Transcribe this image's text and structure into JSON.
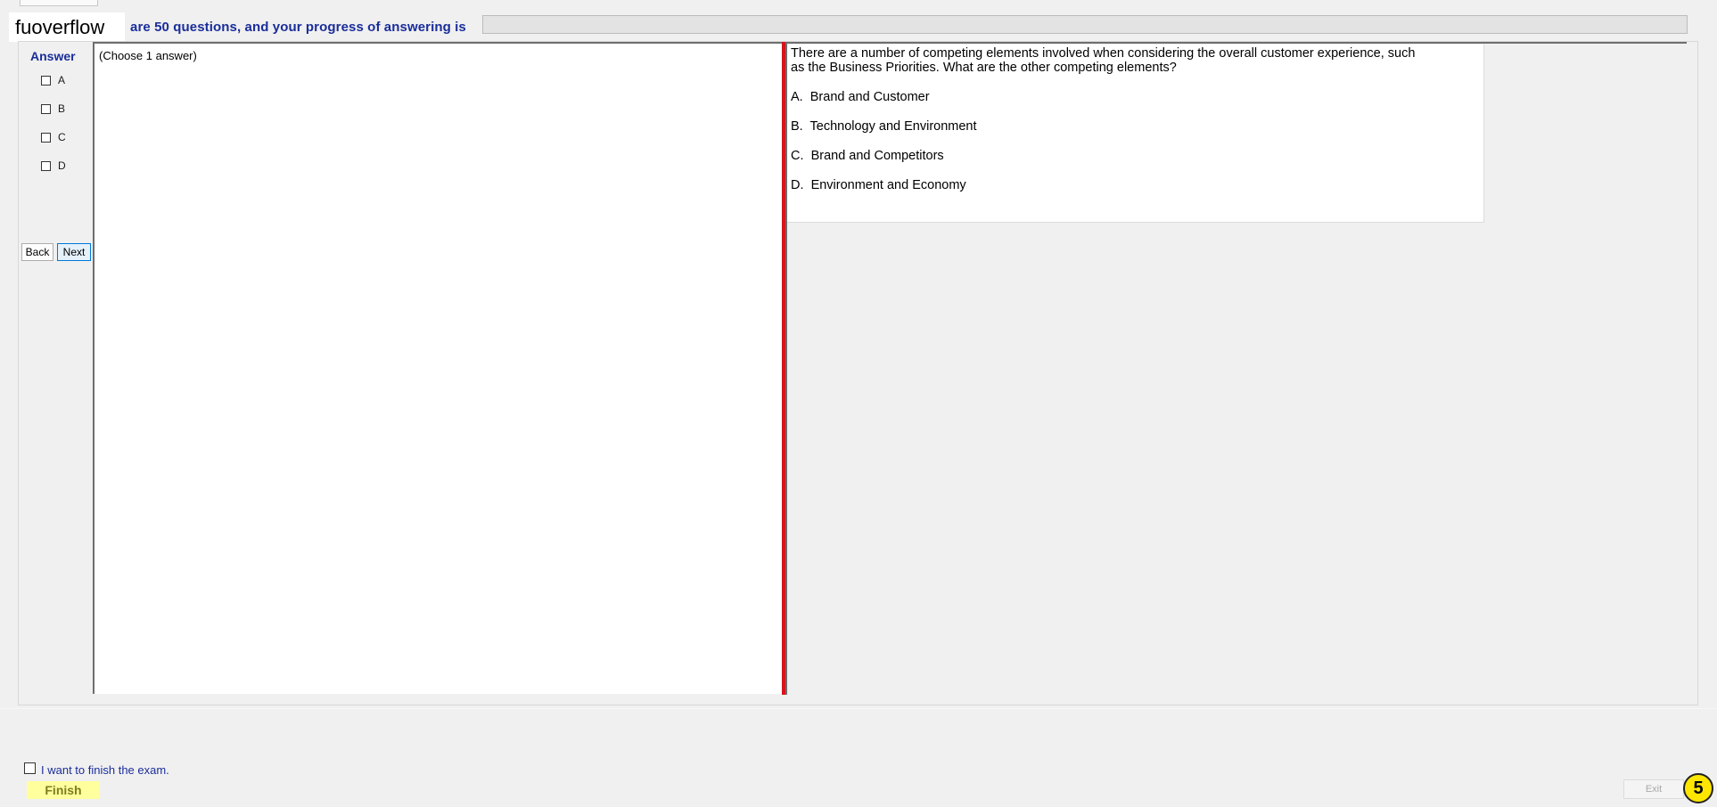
{
  "header": {
    "logo": "fuoverflow",
    "progress_text": "are 50 questions, and your progress of answering is",
    "progress": 0
  },
  "answer_panel": {
    "heading": "Answer",
    "options": [
      {
        "label": "A"
      },
      {
        "label": "B"
      },
      {
        "label": "C"
      },
      {
        "label": "D"
      }
    ],
    "choose_hint": "(Choose 1 answer)"
  },
  "nav": {
    "back_label": "Back",
    "next_label": "Next"
  },
  "question": {
    "line1": "There are a number of competing elements involved when considering the overall customer experience, such",
    "line2": "as the Business Priorities. What are the other competing elements?",
    "choices": [
      {
        "letter": "A.",
        "text": "Brand and Customer"
      },
      {
        "letter": "B.",
        "text": "Technology and Environment"
      },
      {
        "letter": "C.",
        "text": "Brand and Competitors"
      },
      {
        "letter": "D.",
        "text": "Environment and Economy"
      }
    ]
  },
  "footer": {
    "finish_check_label": "I want to finish the exam.",
    "finish_label": "Finish",
    "exit_label": "Exit",
    "badge": "5"
  },
  "colors": {
    "accent_blue": "#1a2d9a",
    "splitter_red": "#d5141c",
    "finish_yellow": "#ffff9e",
    "badge_yellow": "#ffe600"
  }
}
